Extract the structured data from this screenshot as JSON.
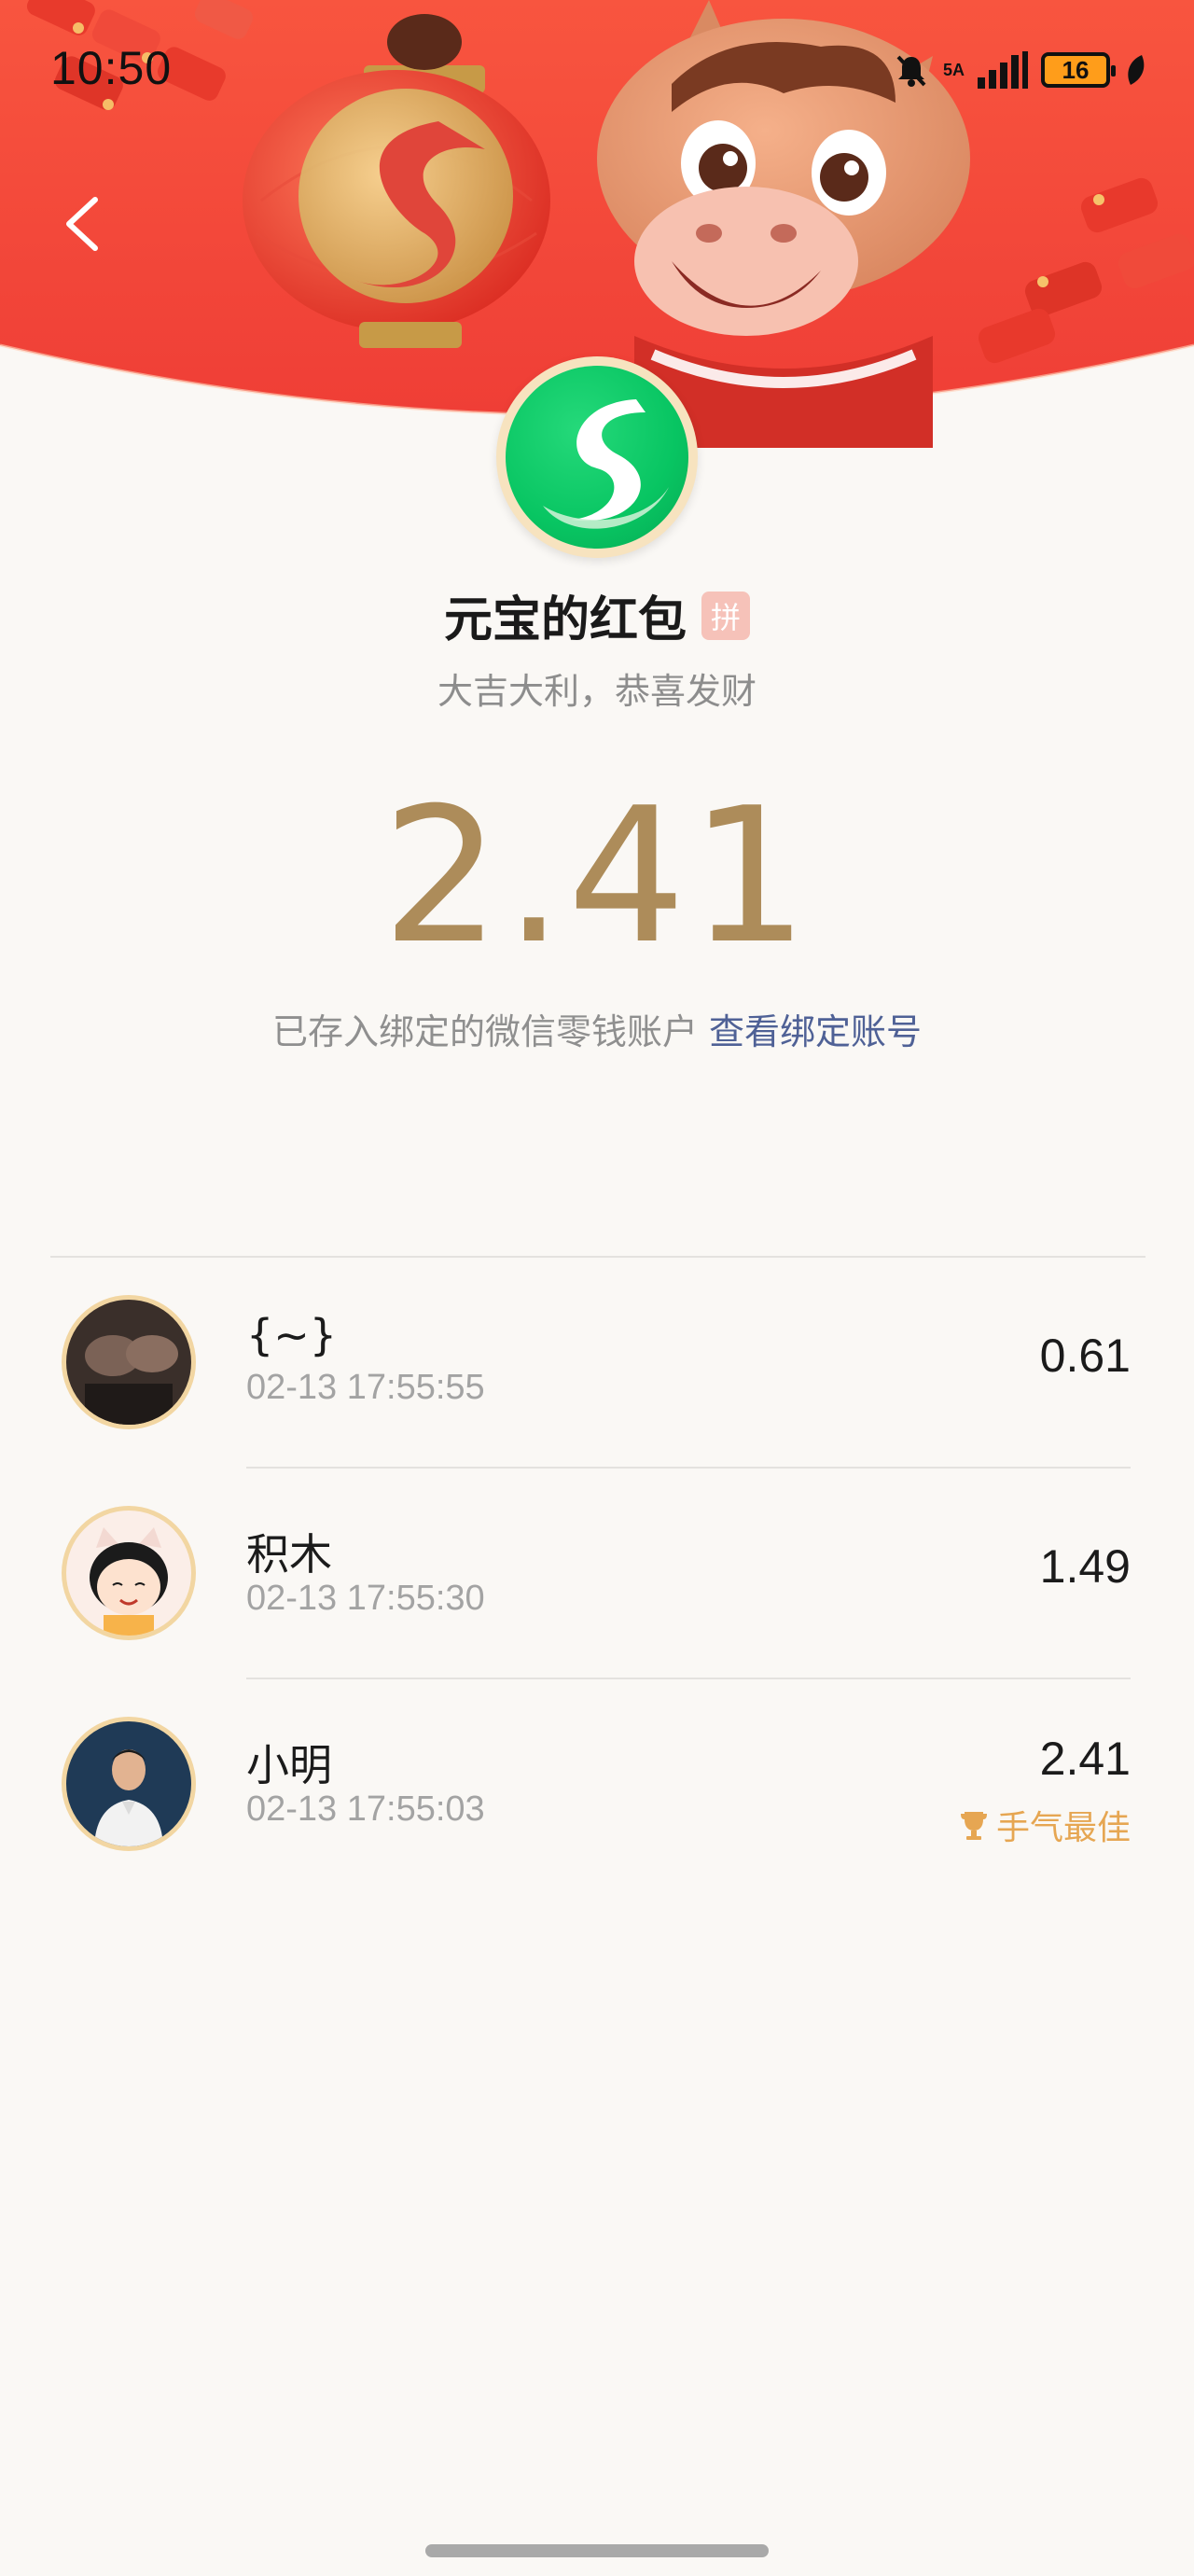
{
  "status_bar": {
    "time": "10:50",
    "network": "5A",
    "battery": "16"
  },
  "envelope": {
    "title": "元宝的红包",
    "badge": "拼",
    "blessing": "大吉大利，恭喜发财",
    "amount": "2.41",
    "deposit_text": "已存入绑定的微信零钱账户",
    "deposit_link": "查看绑定账号"
  },
  "recipients": [
    {
      "name": "{~}",
      "time": "02-13 17:55:55",
      "amount": "0.61"
    },
    {
      "name": "积木",
      "time": "02-13 17:55:30",
      "amount": "1.49"
    },
    {
      "name": "小明",
      "time": "02-13 17:55:03",
      "amount": "2.41",
      "badge": "手气最佳"
    }
  ],
  "colors": {
    "banner_red": "#f24b3c",
    "amount_gold": "#ad8c5a",
    "link_blue": "#4f6196",
    "best_orange": "#e6a652",
    "logo_green": "#08c562"
  }
}
